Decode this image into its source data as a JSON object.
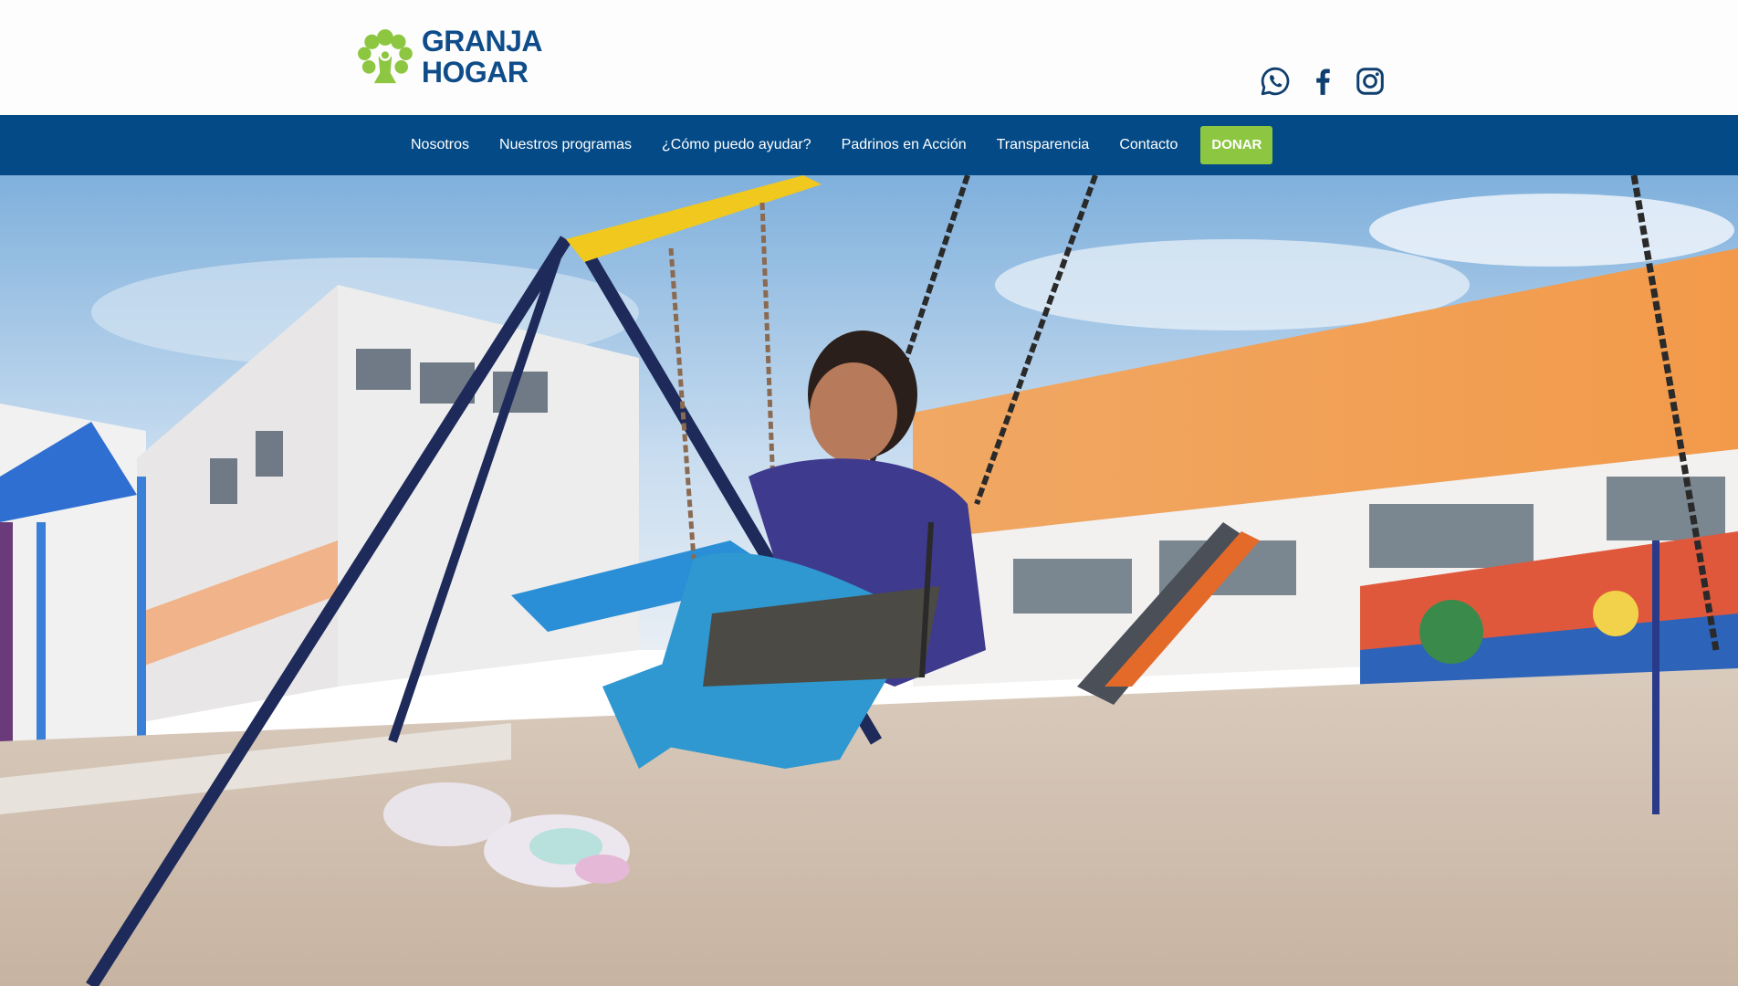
{
  "brand": {
    "name_line1": "GRANJA",
    "name_line2": "HOGAR",
    "logo_icon": "tree-logo-icon",
    "colors": {
      "green": "#8dc640",
      "blue": "#0f4d8a"
    }
  },
  "social": [
    {
      "name": "whatsapp-icon"
    },
    {
      "name": "facebook-icon"
    },
    {
      "name": "instagram-icon"
    }
  ],
  "nav": {
    "items": [
      {
        "label": "Nosotros"
      },
      {
        "label": "Nuestros programas"
      },
      {
        "label": "¿Cómo puedo ayudar?"
      },
      {
        "label": "Padrinos en Acción"
      },
      {
        "label": "Transparencia"
      },
      {
        "label": "Contacto"
      }
    ],
    "donate_label": "DONAR",
    "colors": {
      "bar": "#034a86",
      "donate": "#8dc640"
    }
  },
  "hero": {
    "image": "playground-hero-image"
  }
}
